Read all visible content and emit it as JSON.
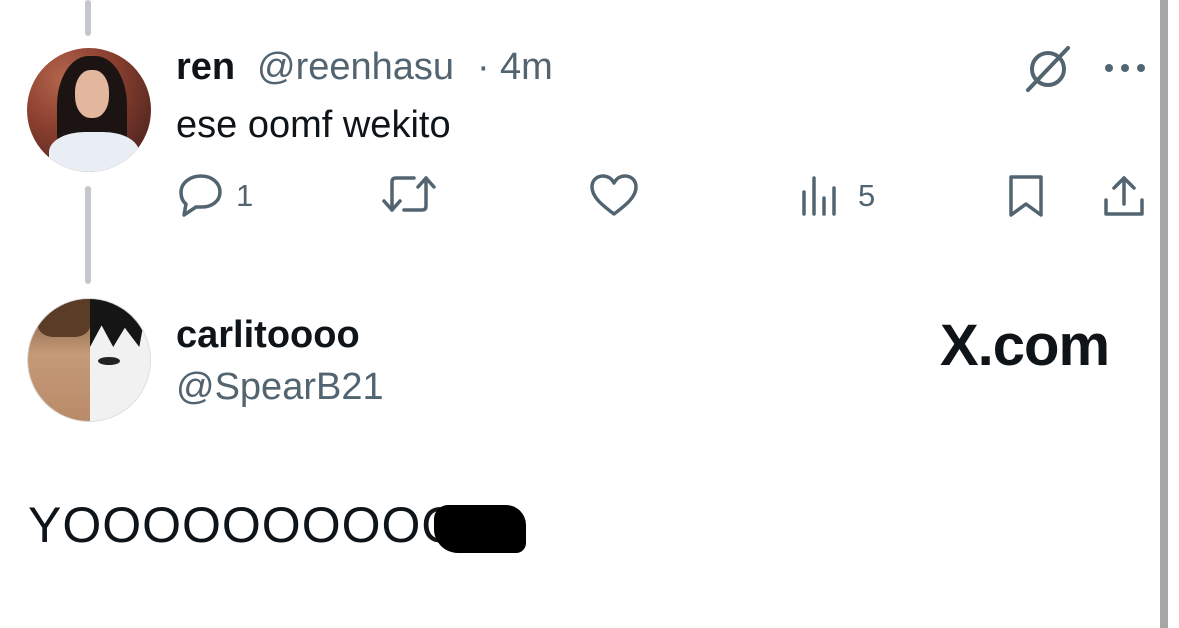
{
  "reply": {
    "display_name": "ren",
    "handle": "@reenhasu",
    "separator": "·",
    "time": "4m",
    "text": "ese oomf wekito",
    "actions": {
      "reply_count": "1",
      "retweet_count": "",
      "like_count": "",
      "views_count": "5"
    }
  },
  "original": {
    "display_name": "carlitoooo",
    "handle": "@SpearB21",
    "text": "YOOOOOOOOOO"
  },
  "watermark": {
    "text": "X.com"
  },
  "icons": {
    "grok": "grok-icon",
    "more": "more-icon",
    "reply": "reply-icon",
    "retweet": "retweet-icon",
    "like": "heart-icon",
    "views": "views-icon",
    "bookmark": "bookmark-icon",
    "share": "share-icon"
  },
  "colors": {
    "text_primary": "#0f1419",
    "text_secondary": "#536471",
    "thread_line": "#c4c8cc"
  }
}
